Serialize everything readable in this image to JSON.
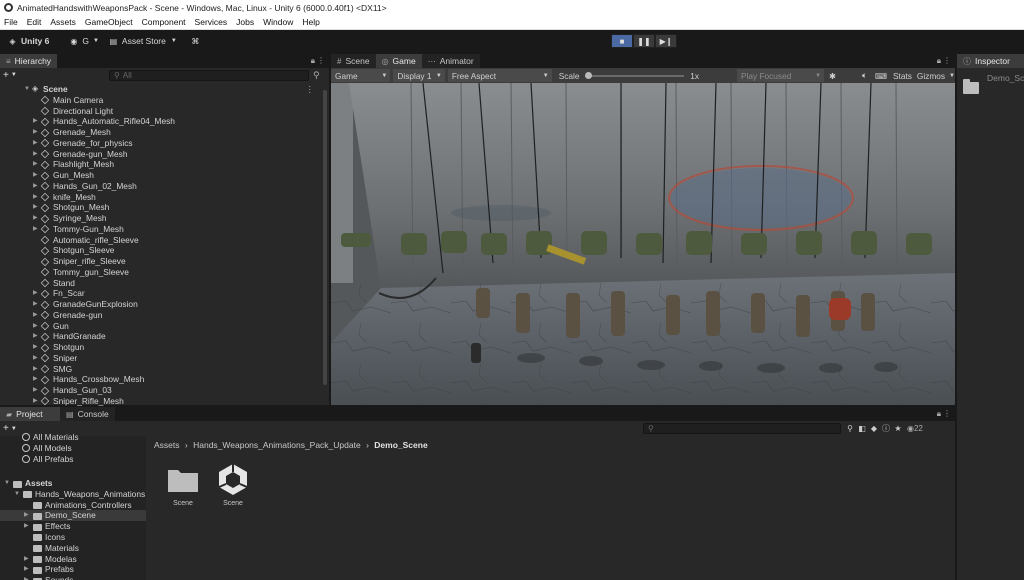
{
  "window": {
    "title": "AnimatedHandswithWeaponsPack - Scene - Windows, Mac, Linux - Unity 6 (6000.0.40f1) <DX11>"
  },
  "menu": [
    "File",
    "Edit",
    "Assets",
    "GameObject",
    "Component",
    "Services",
    "Jobs",
    "Window",
    "Help"
  ],
  "toolbar": {
    "unity_label": "Unity 6",
    "account_label": "G",
    "asset_store_label": "Asset Store"
  },
  "hierarchy": {
    "tab": "Hierarchy",
    "search_placeholder": "All",
    "scene_name": "Scene",
    "items": [
      {
        "label": "Main Camera",
        "arrow": false
      },
      {
        "label": "Directional Light",
        "arrow": false
      },
      {
        "label": "Hands_Automatic_Rifle04_Mesh",
        "arrow": true
      },
      {
        "label": "Grenade_Mesh",
        "arrow": true
      },
      {
        "label": "Grenade_for_physics",
        "arrow": true
      },
      {
        "label": "Grenade-gun_Mesh",
        "arrow": true
      },
      {
        "label": "Flashlight_Mesh",
        "arrow": true
      },
      {
        "label": "Gun_Mesh",
        "arrow": true
      },
      {
        "label": "Hands_Gun_02_Mesh",
        "arrow": true
      },
      {
        "label": "knife_Mesh",
        "arrow": true
      },
      {
        "label": "Shotgun_Mesh",
        "arrow": true
      },
      {
        "label": "Syringe_Mesh",
        "arrow": true
      },
      {
        "label": "Tommy-Gun_Mesh",
        "arrow": true
      },
      {
        "label": "Automatic_rifle_Sleeve",
        "arrow": false
      },
      {
        "label": "Shotgun_Sleeve",
        "arrow": false
      },
      {
        "label": "Sniper_rifle_Sleeve",
        "arrow": false
      },
      {
        "label": "Tommy_gun_Sleeve",
        "arrow": false
      },
      {
        "label": "Stand",
        "arrow": false
      },
      {
        "label": "Fn_Scar",
        "arrow": true
      },
      {
        "label": "GranadeGunExplosion",
        "arrow": true
      },
      {
        "label": "Grenade-gun",
        "arrow": true
      },
      {
        "label": "Gun",
        "arrow": true
      },
      {
        "label": "HandGranade",
        "arrow": true
      },
      {
        "label": "Shotgun",
        "arrow": true
      },
      {
        "label": "Sniper",
        "arrow": true
      },
      {
        "label": "SMG",
        "arrow": true
      },
      {
        "label": "Hands_Crossbow_Mesh",
        "arrow": true
      },
      {
        "label": "Hands_Gun_03",
        "arrow": true
      },
      {
        "label": "Sniper_Rifle_Mesh",
        "arrow": true
      }
    ]
  },
  "center_tabs": {
    "scene": "Scene",
    "game": "Game",
    "animator": "Animator"
  },
  "game_controls": {
    "mode": "Game",
    "display": "Display 1",
    "aspect": "Free Aspect",
    "scale_label": "Scale",
    "scale_value": "1x",
    "play_focused": "Play Focused",
    "stats": "Stats",
    "gizmos": "Gizmos"
  },
  "inspector": {
    "tab": "Inspector",
    "object_name": "Demo_Sc"
  },
  "project": {
    "tab_project": "Project",
    "tab_console": "Console",
    "hidden_count": "22",
    "breadcrumb": [
      "Assets",
      "Hands_Weapons_Animations_Pack_Update",
      "Demo_Scene"
    ],
    "favorites": [
      "All Materials",
      "All Models",
      "All Prefabs"
    ],
    "tree": [
      {
        "label": "Assets",
        "indent": 0,
        "arrow": "down",
        "bold": true
      },
      {
        "label": "Hands_Weapons_Animations",
        "indent": 1,
        "arrow": "down",
        "bold": false
      },
      {
        "label": "Animations_Controllers",
        "indent": 2,
        "arrow": "",
        "bold": false
      },
      {
        "label": "Demo_Scene",
        "indent": 2,
        "arrow": "right",
        "bold": false,
        "selected": true
      },
      {
        "label": "Effects",
        "indent": 2,
        "arrow": "right",
        "bold": false
      },
      {
        "label": "Icons",
        "indent": 2,
        "arrow": "",
        "bold": false
      },
      {
        "label": "Materials",
        "indent": 2,
        "arrow": "",
        "bold": false
      },
      {
        "label": "Modelas",
        "indent": 2,
        "arrow": "right",
        "bold": false
      },
      {
        "label": "Prefabs",
        "indent": 2,
        "arrow": "right",
        "bold": false
      },
      {
        "label": "Sounds",
        "indent": 2,
        "arrow": "right",
        "bold": false
      }
    ],
    "assets": [
      {
        "label": "Scene",
        "type": "folder"
      },
      {
        "label": "Scene",
        "type": "unity-scene"
      }
    ]
  }
}
